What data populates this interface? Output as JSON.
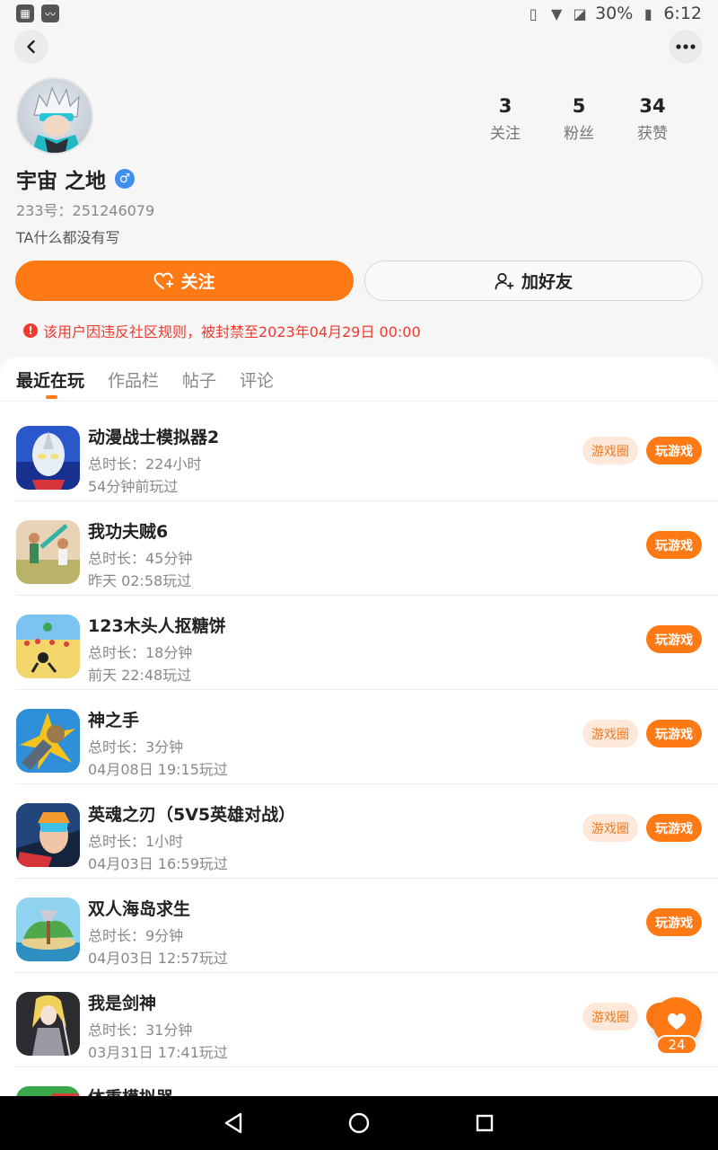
{
  "status_bar": {
    "battery": "30%",
    "time": "6:12",
    "icons": [
      "notification-app-icon",
      "activity-icon",
      "vibrate-icon",
      "wifi-icon",
      "no-sim-icon",
      "battery-icon"
    ]
  },
  "profile": {
    "username": "宇宙 之地",
    "gender_symbol": "♂",
    "user_id": "233号：251246079",
    "bio": "TA什么都没有写",
    "stats": [
      {
        "value": "3",
        "label": "关注"
      },
      {
        "value": "5",
        "label": "粉丝"
      },
      {
        "value": "34",
        "label": "获赞"
      }
    ],
    "follow_label": "关注",
    "add_friend_label": "加好友",
    "ban_notice": "该用户因违反社区规则，被封禁至2023年04月29日 00:00"
  },
  "tabs": [
    "最近在玩",
    "作品栏",
    "帖子",
    "评论"
  ],
  "game_list": {
    "circle_label": "游戏圈",
    "play_label": "玩游戏",
    "items": [
      {
        "name": "动漫战士模拟器2",
        "duration": "总时长：224小时",
        "last_played": "54分钟前玩过",
        "has_circle": true
      },
      {
        "name": "我功夫贼6",
        "duration": "总时长：45分钟",
        "last_played": "昨天 02:58玩过",
        "has_circle": false
      },
      {
        "name": "123木头人抠糖饼",
        "duration": "总时长：18分钟",
        "last_played": "前天 22:48玩过",
        "has_circle": false
      },
      {
        "name": "神之手",
        "duration": "总时长：3分钟",
        "last_played": "04月08日 19:15玩过",
        "has_circle": true
      },
      {
        "name": "英魂之刃（5V5英雄对战）",
        "duration": "总时长：1小时",
        "last_played": "04月03日 16:59玩过",
        "has_circle": true
      },
      {
        "name": "双人海岛求生",
        "duration": "总时长：9分钟",
        "last_played": "04月03日 12:57玩过",
        "has_circle": false
      },
      {
        "name": "我是剑神",
        "duration": "总时长：31分钟",
        "last_played": "03月31日 17:41玩过",
        "has_circle": true
      },
      {
        "name": "体重模拟器",
        "duration": "",
        "last_played": "",
        "has_circle": false
      }
    ]
  },
  "like_fab": {
    "count": "24"
  },
  "colors": {
    "accent": "#ff7a14",
    "ban_red": "#ef3a2f",
    "gender_blue": "#3e8ff2"
  }
}
